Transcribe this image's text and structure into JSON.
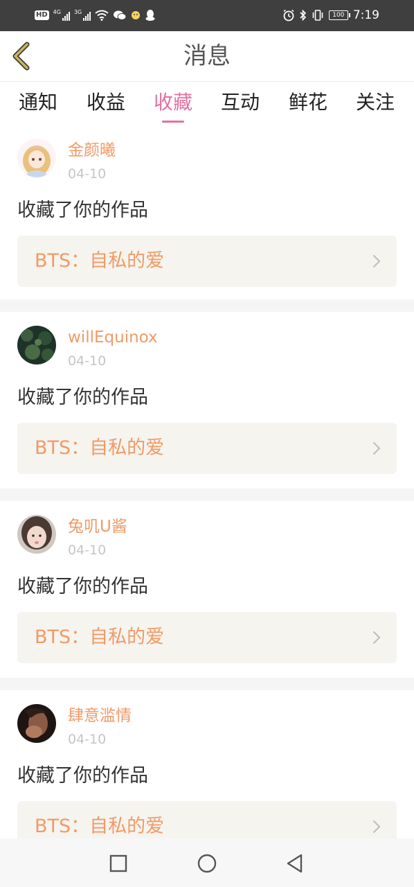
{
  "status_bar": {
    "hd_label": "HD",
    "net1_label": "4G",
    "net2_label": "3G",
    "battery": "100",
    "time": "7:19",
    "left_icons": [
      "wechat-icon",
      "assistant-icon",
      "qq-icon"
    ],
    "right_icons": [
      "alarm-icon",
      "bluetooth-icon",
      "vibrate-icon"
    ]
  },
  "header": {
    "title": "消息",
    "back_icon": "chevron-left-icon",
    "accent_color": "#c9b65a"
  },
  "tabs": {
    "items": [
      {
        "label": "通知",
        "active": false
      },
      {
        "label": "收益",
        "active": false
      },
      {
        "label": "收藏",
        "active": true
      },
      {
        "label": "互动",
        "active": false
      },
      {
        "label": "鲜花",
        "active": false
      },
      {
        "label": "关注",
        "active": false
      }
    ],
    "active_color": "#e56fa2"
  },
  "messages": [
    {
      "name": "金颜曦",
      "date": "04-10",
      "action": "收藏了你的作品",
      "work_title": "BTS：自私的爱"
    },
    {
      "name": "willEquinox",
      "date": "04-10",
      "action": "收藏了你的作品",
      "work_title": "BTS：自私的爱"
    },
    {
      "name": "兔叽U酱",
      "date": "04-10",
      "action": "收藏了你的作品",
      "work_title": "BTS：自私的爱"
    },
    {
      "name": "肆意滥情",
      "date": "04-10",
      "action": "收藏了你的作品",
      "work_title": "BTS：自私的爱"
    }
  ],
  "colors": {
    "name_color": "#f19a66",
    "date_color": "#c5c5c5",
    "card_bg": "#f5f4ef"
  },
  "nav_bar": {
    "icons": [
      "recents-square-icon",
      "home-circle-icon",
      "back-triangle-icon"
    ]
  }
}
